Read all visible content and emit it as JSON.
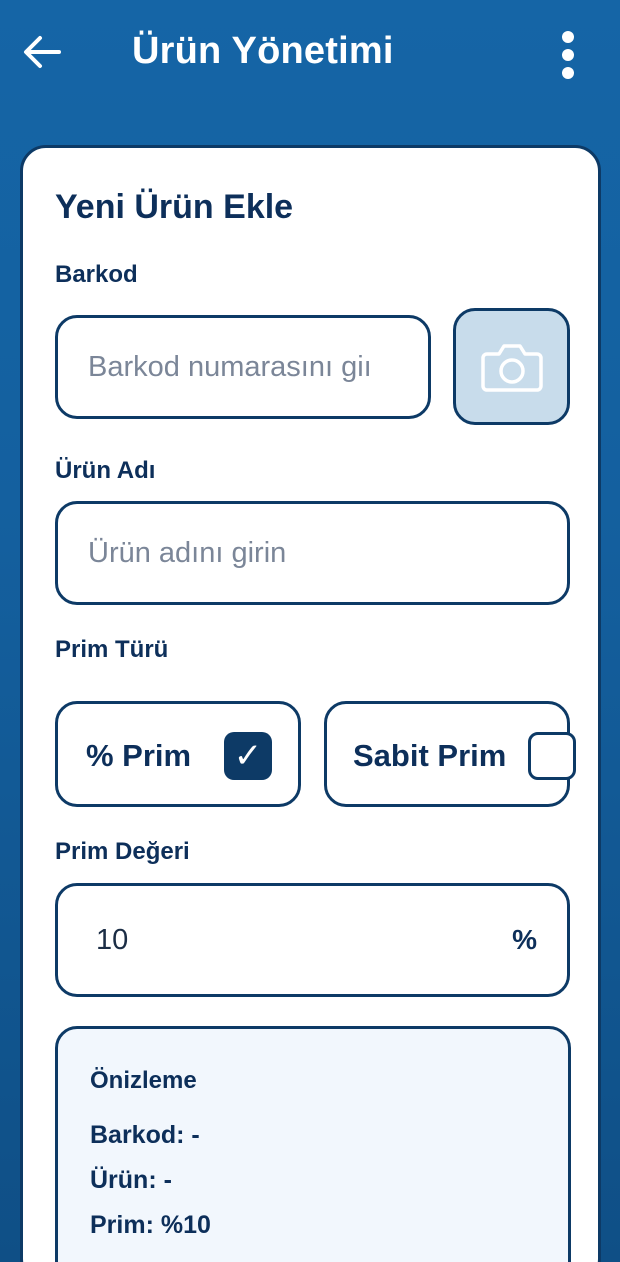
{
  "appbar": {
    "title": "Ürün Yönetimi",
    "back_icon": "arrow-left-icon",
    "menu_icon": "more-vertical-icon"
  },
  "form": {
    "title": "Yeni Ürün Ekle",
    "barcode": {
      "label": "Barkod",
      "placeholder": "Barkod numarasını giı",
      "value": "",
      "scan_icon": "camera-icon"
    },
    "product_name": {
      "label": "Ürün Adı",
      "placeholder": "Ürün adını girin",
      "value": ""
    },
    "bonus_type": {
      "label": "Prim Türü",
      "options": [
        {
          "label": "% Prim",
          "checked": true,
          "check_glyph": "✓"
        },
        {
          "label": "Sabit Prim",
          "checked": false
        }
      ]
    },
    "bonus_value": {
      "label": "Prim Değeri",
      "value": "10",
      "suffix": "%"
    }
  },
  "preview": {
    "title": "Önizleme",
    "barcode_line": "Barkod: -",
    "product_line": "Ürün: -",
    "bonus_line": "Prim: %10"
  },
  "colors": {
    "primary": "#1565a6",
    "navy": "#0d3a66",
    "camera_bg": "#c8dceb",
    "preview_bg": "#f2f7fd"
  }
}
